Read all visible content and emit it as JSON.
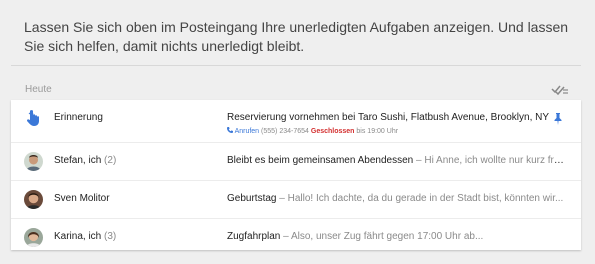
{
  "intro_text": "Lassen Sie sich oben im Posteingang Ihre unerledigten Aufgaben anzeigen. Und lassen Sie sich helfen, damit nichts unerledigt bleibt.",
  "section": {
    "title": "Heute"
  },
  "rows": [
    {
      "sender": "Erinnerung",
      "count": "",
      "subject": "Reservierung vornehmen bei Taro Sushi, Flatbush Avenue, Brooklyn, NY",
      "snippet": "",
      "call_label": "Anrufen",
      "phone": "(555) 234-7654",
      "status": "Geschlossen",
      "hours": "bis 19:00 Uhr"
    },
    {
      "sender": "Stefan, ich",
      "count": "(2)",
      "subject": "Bleibt es beim gemeinsamen Abendessen",
      "snippet": " – Hi Anne, ich wollte nur kurz fragen, o..."
    },
    {
      "sender": "Sven Molitor",
      "count": "",
      "subject": "Geburtstag",
      "snippet": " – Hallo! Ich dachte, da du gerade in der Stadt bist, könnten wir..."
    },
    {
      "sender": "Karina, ich",
      "count": "(3)",
      "subject": "Zugfahrplan",
      "snippet": " – Also, unser Zug fährt gegen 17:00 Uhr ab..."
    }
  ],
  "icons": {
    "reminder": "reminder-finger-icon",
    "pin": "pin-icon",
    "done_all": "done-all-icon",
    "phone": "phone-icon"
  },
  "colors": {
    "accent_blue": "#3b78d8",
    "closed_red": "#d32f2f"
  }
}
